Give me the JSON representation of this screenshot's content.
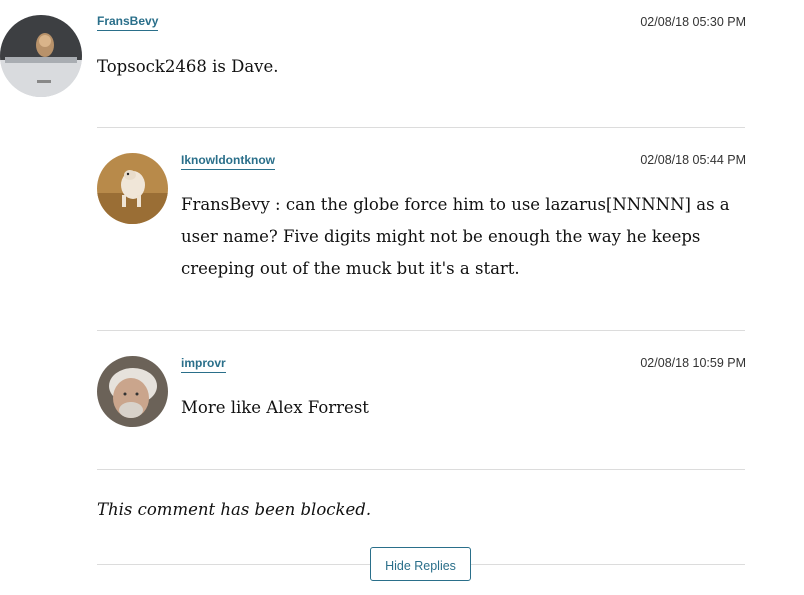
{
  "comments": [
    {
      "username": "FransBevy",
      "timestamp": "02/08/18 05:30 PM",
      "text": "Topsock2468 is Dave.",
      "avatar_icon": "dog-in-car-avatar"
    },
    {
      "username": "Iknowldontknow",
      "timestamp": "02/08/18 05:44 PM",
      "text": "FransBevy : can the globe force him to use lazarus[NNNNN] as a user name? Five digits might not be enough the way he keeps creeping out of the muck but it's a start.",
      "avatar_icon": "small-dog-avatar"
    },
    {
      "username": "improvr",
      "timestamp": "02/08/18 10:59 PM",
      "text": "More like Alex Forrest",
      "avatar_icon": "man-face-avatar"
    }
  ],
  "blocked_message": "This comment has been blocked.",
  "hide_replies_label": "Hide Replies",
  "colors": {
    "accent": "#2a6f8a",
    "divider": "#dcdcdc",
    "text": "#111111"
  }
}
